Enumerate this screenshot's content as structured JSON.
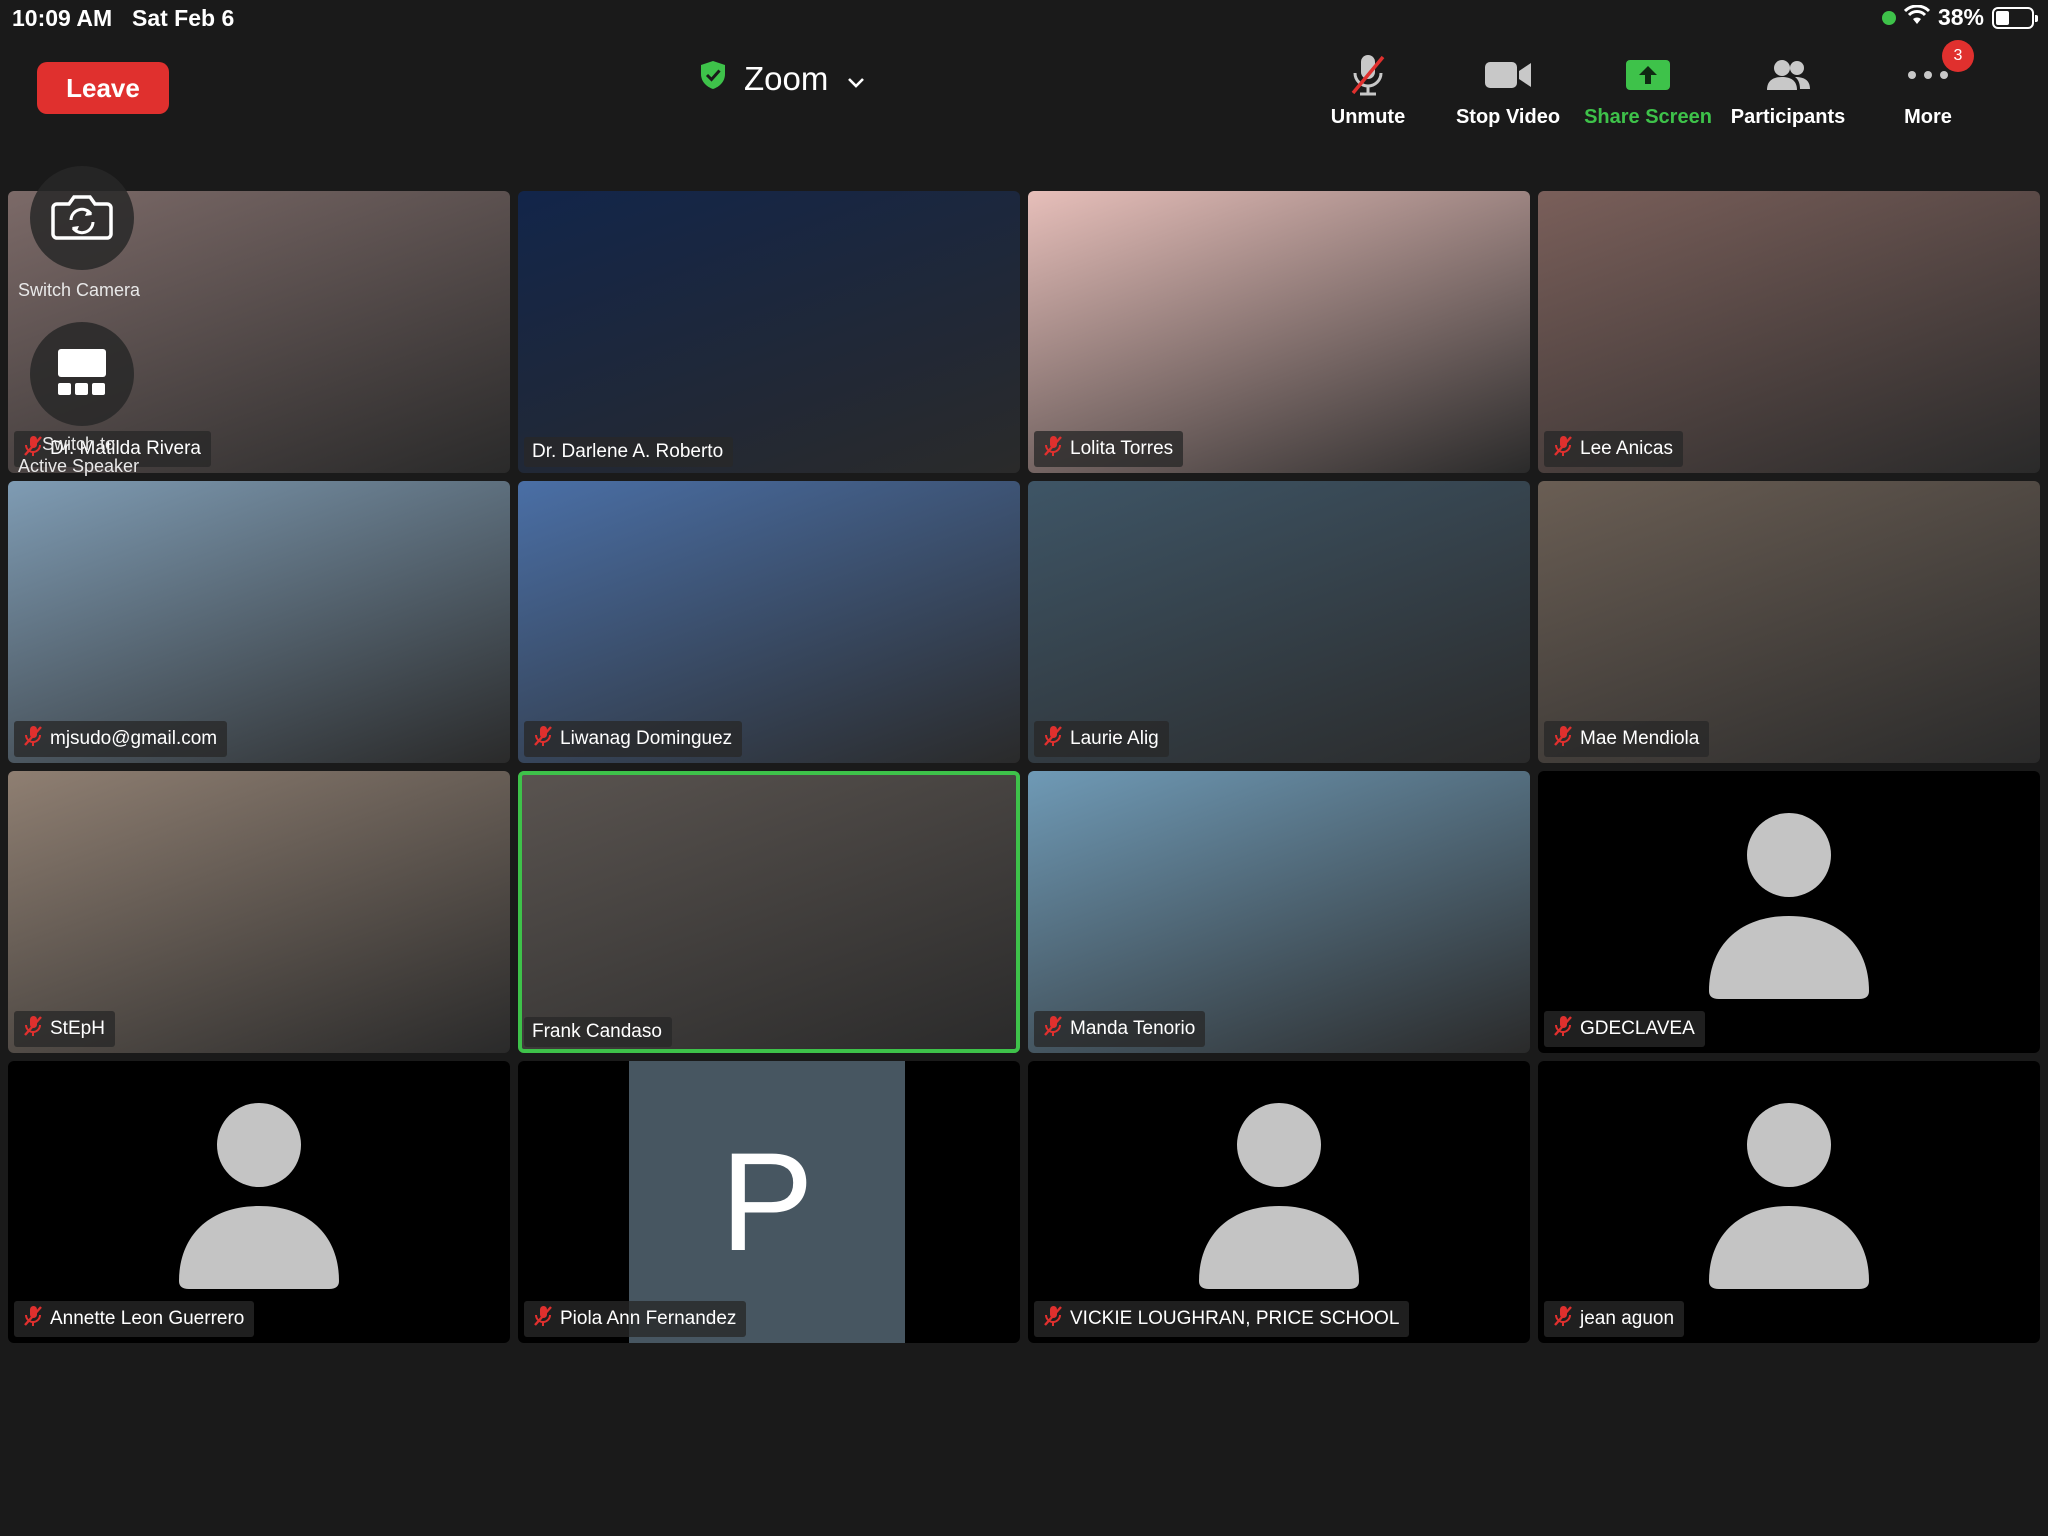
{
  "status_bar": {
    "time": "10:09 AM",
    "date": "Sat Feb 6",
    "battery": "38%"
  },
  "header": {
    "leave_label": "Leave",
    "title": "Zoom"
  },
  "toolbar": {
    "unmute": "Unmute",
    "stop_video": "Stop Video",
    "share_screen": "Share Screen",
    "participants": "Participants",
    "more": "More",
    "more_badge": "3"
  },
  "overlay": {
    "switch_camera": "Switch Camera",
    "switch_active_line1": "Switch to",
    "switch_active_line2": "Active Speaker"
  },
  "participants": [
    {
      "name": "Dr. Matilda Rivera",
      "muted": true,
      "bg": "#7c6a68"
    },
    {
      "name": "Dr. Darlene A. Roberto",
      "muted": false,
      "bg": "#12254a"
    },
    {
      "name": "Lolita Torres",
      "muted": true,
      "bg": "#e7bfba"
    },
    {
      "name": "Lee Anicas",
      "muted": true,
      "bg": "#7a5f5a"
    },
    {
      "name": "mjsudo@gmail.com",
      "muted": true,
      "bg": "#7f9cb4"
    },
    {
      "name": "Liwanag Dominguez",
      "muted": true,
      "bg": "#4a6fa6"
    },
    {
      "name": "Laurie Alig",
      "muted": true,
      "bg": "#3e5566"
    },
    {
      "name": "Mae Mendiola",
      "muted": true,
      "bg": "#6a5e54"
    },
    {
      "name": "StEpH",
      "muted": true,
      "bg": "#8f7f72"
    },
    {
      "name": "Frank Candaso",
      "muted": false,
      "bg": "#5a5450"
    },
    {
      "name": "Manda Tenorio",
      "muted": true,
      "bg": "#6f9ab6"
    },
    {
      "name": "GDECLAVEA",
      "muted": true,
      "avatar": true
    },
    {
      "name": "Annette Leon Guerrero",
      "muted": true,
      "avatar": true
    },
    {
      "name": "Piola Ann Fernandez",
      "muted": true,
      "initial": "P"
    },
    {
      "name": "VICKIE LOUGHRAN, PRICE SCHOOL",
      "muted": true,
      "avatar": true
    },
    {
      "name": "jean aguon",
      "muted": true,
      "avatar": true
    }
  ],
  "active_speaker_index": 9,
  "colors": {
    "leave": "#e0302e",
    "share_green": "#3ec24a",
    "active_border": "#3ec24a",
    "muted_red": "#e0302e",
    "badge": "#e0302e"
  }
}
